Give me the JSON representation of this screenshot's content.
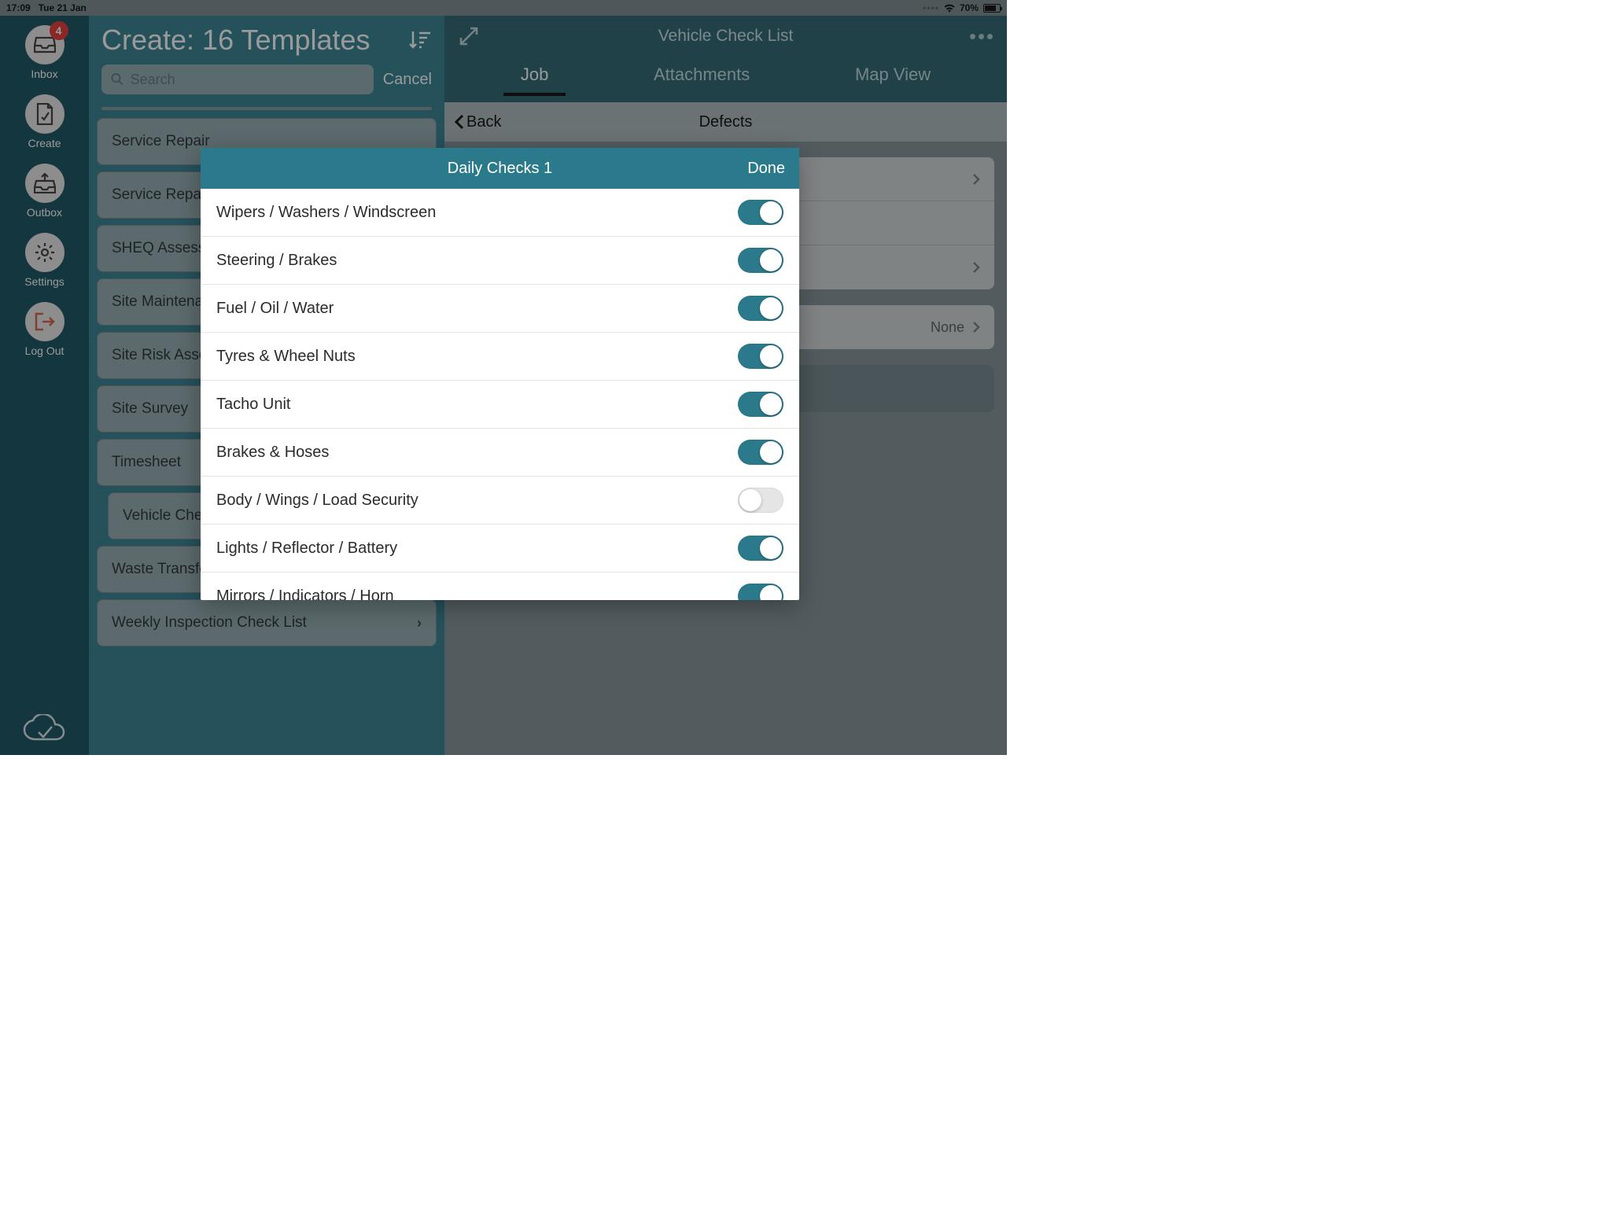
{
  "status": {
    "time": "17:09",
    "date": "Tue 21 Jan",
    "battery": "70%"
  },
  "sidebar": {
    "items": [
      {
        "label": "Inbox",
        "badge": "4"
      },
      {
        "label": "Create"
      },
      {
        "label": "Outbox"
      },
      {
        "label": "Settings"
      },
      {
        "label": "Log Out"
      }
    ]
  },
  "create": {
    "title": "Create: 16 Templates",
    "search_placeholder": "Search",
    "cancel_label": "Cancel",
    "templates": [
      "Service Repair",
      "Service Repair",
      "SHEQ Assessment",
      "Site Maintenance",
      "Site Risk Assessment",
      "Site Survey",
      "Timesheet",
      "Vehicle Check List",
      "Waste Transfer Note",
      "Weekly Inspection Check List"
    ]
  },
  "main": {
    "title": "Vehicle Check List",
    "tabs": [
      "Job",
      "Attachments",
      "Map View"
    ],
    "back_label": "Back",
    "defects_label": "Defects",
    "none_label": "None"
  },
  "modal": {
    "title": "Daily Checks 1",
    "done_label": "Done",
    "items": [
      {
        "label": "Wipers / Washers / Windscreen",
        "on": true
      },
      {
        "label": "Steering / Brakes",
        "on": true
      },
      {
        "label": "Fuel / Oil / Water",
        "on": true
      },
      {
        "label": "Tyres & Wheel Nuts",
        "on": true
      },
      {
        "label": "Tacho Unit",
        "on": true
      },
      {
        "label": "Brakes & Hoses",
        "on": true
      },
      {
        "label": "Body / Wings / Load Security",
        "on": false
      },
      {
        "label": "Lights / Reflector / Battery",
        "on": true
      },
      {
        "label": "Mirrors / Indicators / Horn",
        "on": true
      }
    ]
  }
}
